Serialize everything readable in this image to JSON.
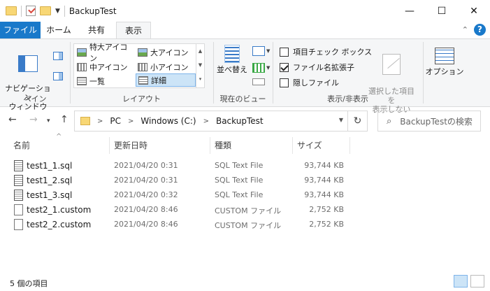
{
  "window": {
    "title": "BackupTest"
  },
  "ribbon_tabs": [
    "ファイル",
    "ホーム",
    "共有",
    "表示"
  ],
  "ribbon": {
    "pane": {
      "nav_pane": "ナビゲーション\nウィンドウ",
      "label": "ペイン"
    },
    "layout": {
      "items": [
        "特大アイコン",
        "大アイコン",
        "中アイコン",
        "小アイコン",
        "一覧",
        "詳細"
      ],
      "selected": "詳細",
      "label": "レイアウト"
    },
    "current_view": {
      "sort_by": "並べ替え",
      "label": "現在のビュー"
    },
    "show_hide": {
      "item_checkboxes": {
        "label": "項目チェック ボックス",
        "checked": false
      },
      "file_extensions": {
        "label": "ファイル名拡張子",
        "checked": true
      },
      "hidden_items": {
        "label": "隠しファイル",
        "checked": false
      },
      "hide_selected": "選択した項目を\n表示しない",
      "label": "表示/非表示"
    },
    "options": "オプション"
  },
  "address": {
    "crumbs": [
      "PC",
      "Windows (C:)",
      "BackupTest"
    ],
    "search_placeholder": "BackupTestの検索"
  },
  "columns": {
    "name": "名前",
    "date": "更新日時",
    "type": "種類",
    "size": "サイズ"
  },
  "files": [
    {
      "name": "test1_1.sql",
      "date": "2021/04/20 0:31",
      "type": "SQL Text File",
      "size": "93,744 KB",
      "icon": "sql-file-icon"
    },
    {
      "name": "test1_2.sql",
      "date": "2021/04/20 0:31",
      "type": "SQL Text File",
      "size": "93,744 KB",
      "icon": "sql-file-icon"
    },
    {
      "name": "test1_3.sql",
      "date": "2021/04/20 0:32",
      "type": "SQL Text File",
      "size": "93,744 KB",
      "icon": "sql-file-icon"
    },
    {
      "name": "test2_1.custom",
      "date": "2021/04/20 8:46",
      "type": "CUSTOM ファイル",
      "size": "2,752 KB",
      "icon": "blank-file-icon"
    },
    {
      "name": "test2_2.custom",
      "date": "2021/04/20 8:46",
      "type": "CUSTOM ファイル",
      "size": "2,752 KB",
      "icon": "blank-file-icon"
    }
  ],
  "status": {
    "item_count": "5 個の項目"
  },
  "colors": {
    "accent": "#1979ca",
    "selection": "#cce4f7"
  }
}
